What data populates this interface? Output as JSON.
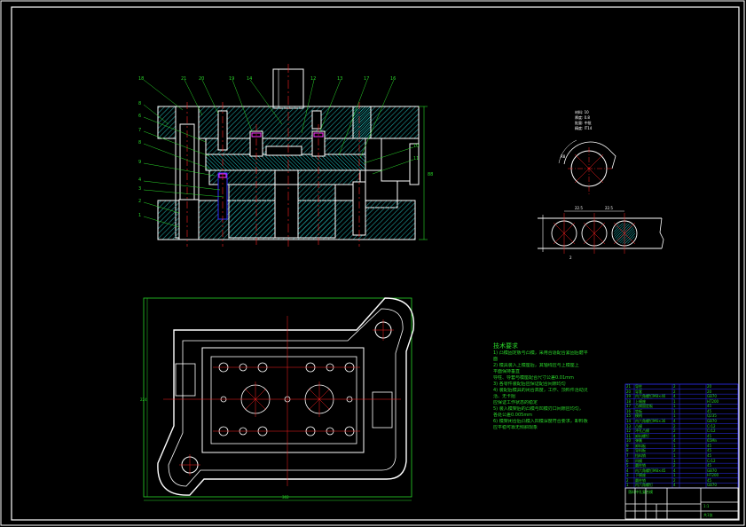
{
  "drawing": {
    "background": "#000000",
    "colors": {
      "outline": "#ffffff",
      "centerline": "#ff2020",
      "dimension": "#27d827",
      "hatch": "#1e9e9e",
      "hatch_alt": "#1cc8c8",
      "blue": "#3030ff",
      "magenta": "#ff30ff",
      "leader": "#2bd92b"
    }
  },
  "section_view": {
    "callouts_top": [
      "18",
      "21",
      "20",
      "19",
      "14",
      "12",
      "13",
      "17",
      "16"
    ],
    "callouts_left": [
      "8",
      "6",
      "7",
      "8",
      "9",
      "4",
      "3",
      "2",
      "1"
    ],
    "callouts_right": [
      "10",
      "11"
    ],
    "dimension_right": "88"
  },
  "part_view": {
    "specs": [
      "材料: 10",
      "厚度: 0.8",
      "批量: 中批",
      "精度: IT14"
    ],
    "angle_label": "R8"
  },
  "strip_layout": {
    "dims": [
      "22.5",
      "22.5",
      "2"
    ]
  },
  "plan_view": {
    "dimension_left": "224",
    "dimension_bottom": "302"
  },
  "technical_requirements": {
    "title": "技术要求",
    "lines": [
      "1) 凸模固定板与凸模，采用合适配合紧固后磨平",
      "面",
      "2) 模具装入上模座后，其轴线应与上模座上",
      "平面保持垂直",
      "   导柱、导套与模座配合尺寸公差0.01mm",
      "3) 各零件装配后应保证配合间隙均匀",
      "4) 装配后模具的闭合高度，工作、顶料件活动灵",
      "活、无卡阻",
      "   应保证工作状态的稳定",
      "5) 装入模架后的凸模与凹模刃口间隙应均匀，",
      "各处公差0.005mm",
      "6) 模架闭合后凸模入凹模深度符合要求，卸料板",
      "应平稳可靠无倾斜现象"
    ]
  },
  "bom": {
    "rows": [
      [
        "21",
        "导柱",
        "2",
        "20"
      ],
      [
        "20",
        "导套",
        "2",
        "20"
      ],
      [
        "19",
        "内六角螺钉M8×40",
        "4",
        "GB70"
      ],
      [
        "18",
        "上模座",
        "1",
        "HT200"
      ],
      [
        "17",
        "凸模固定板",
        "1",
        "45"
      ],
      [
        "16",
        "垫板",
        "1",
        "45"
      ],
      [
        "15",
        "模柄",
        "1",
        "Q235"
      ],
      [
        "14",
        "内六角螺钉M6×30",
        "4",
        "GB70"
      ],
      [
        "13",
        "凸模",
        "2",
        "Cr12"
      ],
      [
        "12",
        "冲孔凸模",
        "2",
        "Cr12"
      ],
      [
        "11",
        "卸料螺钉",
        "4",
        "45"
      ],
      [
        "10",
        "弹簧",
        "4",
        "65Mn"
      ],
      [
        "9",
        "卸料板",
        "1",
        "45"
      ],
      [
        "8",
        "导料板",
        "2",
        "45"
      ],
      [
        "7",
        "挡料销",
        "1",
        "45"
      ],
      [
        "6",
        "凹模",
        "1",
        "Cr12"
      ],
      [
        "5",
        "圆柱销",
        "2",
        "45"
      ],
      [
        "4",
        "内六角螺钉M8×45",
        "4",
        "GB70"
      ],
      [
        "3",
        "下模座",
        "1",
        "HT200"
      ],
      [
        "2",
        "圆柱销",
        "2",
        "45"
      ],
      [
        "1",
        "内六角螺钉",
        "4",
        "GB70"
      ]
    ]
  },
  "title_block": {
    "drawing_name": "落料冲孔复合模",
    "scale": "1:1",
    "sheet": "共1张"
  }
}
